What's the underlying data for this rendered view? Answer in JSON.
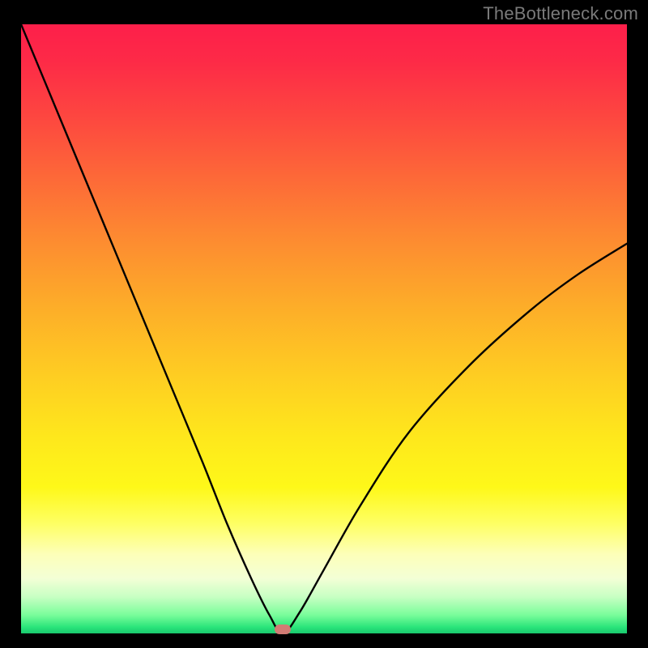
{
  "watermark": "TheBottleneck.com",
  "plot": {
    "width_frac": 1.0,
    "height_frac": 1.0
  },
  "marker": {
    "x_frac": 0.432,
    "y_frac": 0.994
  },
  "chart_data": {
    "type": "line",
    "title": "",
    "xlabel": "",
    "ylabel": "",
    "xlim": [
      0,
      1
    ],
    "ylim": [
      0,
      1
    ],
    "note": "Axes unlabeled; values are normalized fractions of the plot area. y represents bottleneck magnitude (0 = no bottleneck at bottom, 1 = top). Minimum occurs near x≈0.43 where the red marker sits.",
    "series": [
      {
        "name": "bottleneck-curve",
        "x": [
          0.0,
          0.05,
          0.1,
          0.15,
          0.2,
          0.25,
          0.3,
          0.34,
          0.38,
          0.41,
          0.432,
          0.46,
          0.5,
          0.56,
          0.64,
          0.74,
          0.84,
          0.92,
          1.0
        ],
        "y": [
          1.0,
          0.88,
          0.76,
          0.64,
          0.52,
          0.4,
          0.28,
          0.18,
          0.09,
          0.03,
          0.0,
          0.035,
          0.105,
          0.21,
          0.33,
          0.44,
          0.53,
          0.59,
          0.64
        ]
      }
    ],
    "marker_point": {
      "x": 0.432,
      "y": 0.006
    },
    "background_gradient": {
      "top": "#fd1f4a",
      "mid": "#fee81c",
      "bottom": "#19c86e"
    }
  }
}
